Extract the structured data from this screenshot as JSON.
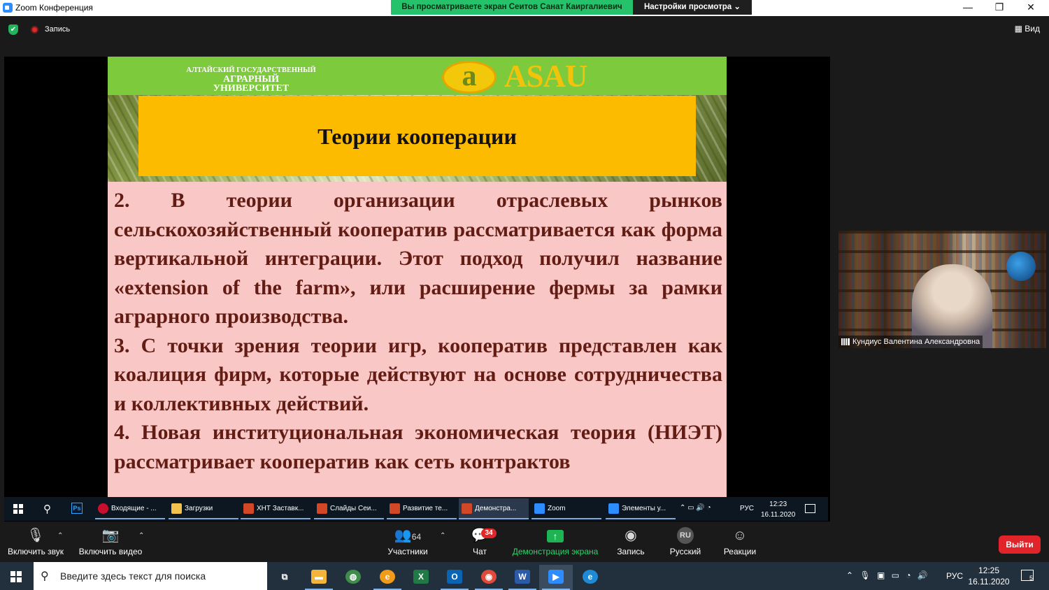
{
  "titlebar": {
    "app_title": "Zoom Конференция",
    "share_banner": "Вы просматриваете экран Сеитов Санат Каиргалиевич",
    "view_options": "Настройки просмотра ⌄",
    "minimize": "—",
    "maximize": "❐",
    "close": "✕"
  },
  "topbar": {
    "shield_glyph": "✔",
    "recording_label": "Запись",
    "view_label": "Вид",
    "view_glyph": "▦"
  },
  "slide": {
    "logo_line1": "АЛТАЙСКИЙ ГОСУДАРСТВЕННЫЙ",
    "logo_line2": "АГРАРНЫЙ УНИВЕРСИТЕТ",
    "logo_emblem": "a",
    "logo_text": "ASAU",
    "title": "Теории кооперации",
    "paragraphs": [
      "2. В теории организации отраслевых рынков сельскохозяйственный кооператив рассматривается как форма вертикальной интеграции. Этот подход получил название «extension of  the farm», или расширение фермы за рамки аграрного производства.",
      "3. С точки зрения теории игр, кооператив представлен как коалиция фирм, которые действуют на основе сотрудничества и коллективных действий.",
      "4. Новая институциональная экономическая теория (НИЭТ) рассматривает кооператив как сеть контрактов"
    ]
  },
  "inner_taskbar": {
    "search_glyph": "⚲",
    "ps_label": "Ps",
    "apps": [
      {
        "label": "Входящие - ...",
        "color": "#c8102e"
      },
      {
        "label": "Загрузки",
        "color": "#f2c14e"
      },
      {
        "label": "ХНТ Заставк...",
        "color": "#d24726"
      },
      {
        "label": "Слайды Сеи...",
        "color": "#d24726"
      },
      {
        "label": "Развитие те...",
        "color": "#d24726"
      },
      {
        "label": "Демонстра...",
        "color": "#d24726"
      },
      {
        "label": "Zoom",
        "color": "#2d8cff"
      },
      {
        "label": "Элементы у...",
        "color": "#2d8cff"
      }
    ],
    "tray_glyphs": "⌃ ▭ 🔊 ◔",
    "lang": "РУС",
    "time": "12:23",
    "date": "16.11.2020"
  },
  "participant": {
    "name": "Кундиус Валентина Александровна"
  },
  "controls": {
    "audio": {
      "label": "Включить звук",
      "glyph": "🎙"
    },
    "video": {
      "label": "Включить видео",
      "glyph": "📷"
    },
    "caret": "⌃",
    "participants": {
      "label": "Участники",
      "count": "64",
      "glyph": "👥"
    },
    "chat": {
      "label": "Чат",
      "badge": "34",
      "glyph": "💬"
    },
    "share": {
      "label": "Демонстрация экрана",
      "glyph": "↑"
    },
    "record": {
      "label": "Запись",
      "glyph": "◉"
    },
    "language": {
      "label": "Русский",
      "glyph": "RU"
    },
    "reactions": {
      "label": "Реакции",
      "glyph": "☺"
    },
    "leave": "Выйти",
    "colors": {
      "leave": "#e0242a",
      "share": "#1fb453",
      "badge": "#e02828"
    }
  },
  "win_taskbar": {
    "search_glyph": "⚲",
    "search_placeholder": "Введите здесь текст для поиска",
    "apps": [
      {
        "name": "task-view",
        "glyph": "⧉",
        "color": "transparent"
      },
      {
        "name": "file-explorer",
        "glyph": "▬",
        "color": "#f2b53a"
      },
      {
        "name": "maps",
        "glyph": "◍",
        "color": "#3f8d4a"
      },
      {
        "name": "browser",
        "glyph": "e",
        "color": "#f29a1a"
      },
      {
        "name": "excel",
        "glyph": "X",
        "color": "#1f7a45"
      },
      {
        "name": "outlook",
        "glyph": "O",
        "color": "#0a64b3"
      },
      {
        "name": "chrome",
        "glyph": "◉",
        "color": "#e04a3a"
      },
      {
        "name": "word",
        "glyph": "W",
        "color": "#2b5aa8"
      },
      {
        "name": "zoom",
        "glyph": "▶",
        "color": "#2d8cff"
      },
      {
        "name": "edge",
        "glyph": "e",
        "color": "#1f8ad6"
      }
    ],
    "tray_glyphs": "⌃ 🎙 ▣ ▭ ◔ 🔊",
    "lang": "РУС",
    "time": "12:25",
    "date": "16.11.2020",
    "notifications": "5"
  }
}
